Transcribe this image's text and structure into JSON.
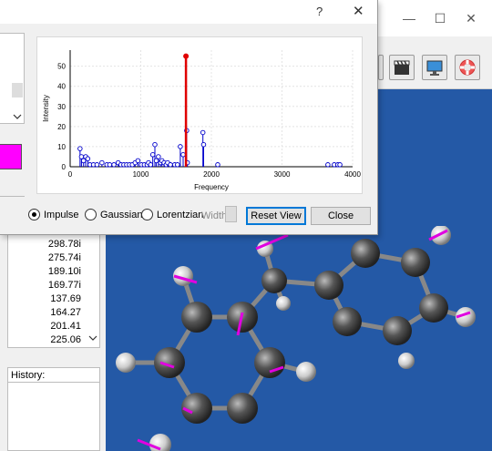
{
  "dialog": {
    "help_glyph": "?",
    "close_glyph": "✕",
    "color_swatch": "#ff00ff"
  },
  "main_window": {
    "minimize_glyph": "—",
    "maximize_glyph": "☐",
    "close_glyph": "✕",
    "background_color": "#2459a6"
  },
  "plot_controls": {
    "impulse_label": "Impulse",
    "gaussian_label": "Gaussian",
    "lorentzian_label": "Lorentzian",
    "width_label": "Width",
    "reset_view_label": "Reset View",
    "close_label": "Close",
    "selected_mode": "Impulse"
  },
  "frequencies": [
    "298.78i",
    "275.74i",
    "189.10i",
    "169.77i",
    "137.69",
    "164.27",
    "201.41",
    "225.06"
  ],
  "history": {
    "label": "History:"
  },
  "chart_data": {
    "type": "impulse",
    "xlabel": "Frequency",
    "ylabel": "Intensity",
    "xlim": [
      0,
      4000
    ],
    "ylim": [
      0,
      58
    ],
    "xticks": [
      0,
      1000,
      2000,
      3000,
      4000
    ],
    "yticks": [
      0,
      10,
      20,
      30,
      40,
      50
    ],
    "series_color": "#0000cc",
    "highlight_color": "#e00000",
    "highlight": {
      "x": 1640,
      "y": 55
    },
    "peaks": [
      {
        "x": 140,
        "y": 9
      },
      {
        "x": 160,
        "y": 5
      },
      {
        "x": 190,
        "y": 3
      },
      {
        "x": 220,
        "y": 5
      },
      {
        "x": 250,
        "y": 4
      },
      {
        "x": 280,
        "y": 1
      },
      {
        "x": 330,
        "y": 1
      },
      {
        "x": 380,
        "y": 1
      },
      {
        "x": 450,
        "y": 2
      },
      {
        "x": 520,
        "y": 1
      },
      {
        "x": 560,
        "y": 1
      },
      {
        "x": 620,
        "y": 1
      },
      {
        "x": 680,
        "y": 2
      },
      {
        "x": 720,
        "y": 1
      },
      {
        "x": 760,
        "y": 1
      },
      {
        "x": 800,
        "y": 1
      },
      {
        "x": 840,
        "y": 1
      },
      {
        "x": 880,
        "y": 1
      },
      {
        "x": 920,
        "y": 2
      },
      {
        "x": 960,
        "y": 3
      },
      {
        "x": 1010,
        "y": 1
      },
      {
        "x": 1050,
        "y": 1
      },
      {
        "x": 1090,
        "y": 1
      },
      {
        "x": 1110,
        "y": 2
      },
      {
        "x": 1140,
        "y": 1
      },
      {
        "x": 1170,
        "y": 6
      },
      {
        "x": 1200,
        "y": 11
      },
      {
        "x": 1220,
        "y": 3
      },
      {
        "x": 1250,
        "y": 5
      },
      {
        "x": 1280,
        "y": 2
      },
      {
        "x": 1300,
        "y": 3
      },
      {
        "x": 1330,
        "y": 2
      },
      {
        "x": 1360,
        "y": 1
      },
      {
        "x": 1380,
        "y": 2
      },
      {
        "x": 1420,
        "y": 1
      },
      {
        "x": 1480,
        "y": 1
      },
      {
        "x": 1520,
        "y": 1
      },
      {
        "x": 1560,
        "y": 10
      },
      {
        "x": 1600,
        "y": 6
      },
      {
        "x": 1650,
        "y": 18
      },
      {
        "x": 1660,
        "y": 2
      },
      {
        "x": 1880,
        "y": 17
      },
      {
        "x": 1890,
        "y": 11
      },
      {
        "x": 2090,
        "y": 1
      },
      {
        "x": 3650,
        "y": 1
      },
      {
        "x": 3740,
        "y": 1
      },
      {
        "x": 3790,
        "y": 1
      },
      {
        "x": 3820,
        "y": 1
      }
    ]
  }
}
